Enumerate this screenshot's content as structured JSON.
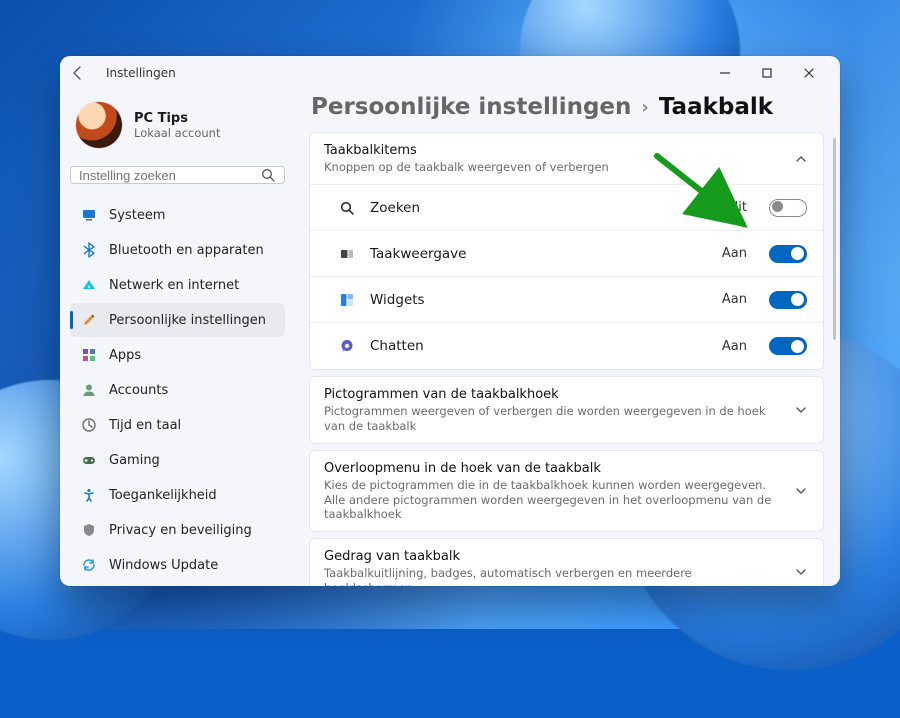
{
  "window": {
    "title": "Instellingen"
  },
  "profile": {
    "name": "PC Tips",
    "sub": "Lokaal account"
  },
  "search": {
    "placeholder": "Instelling zoeken"
  },
  "nav": [
    {
      "label": "Systeem",
      "icon": "display-icon",
      "selected": false,
      "color": "#1976d2"
    },
    {
      "label": "Bluetooth en apparaten",
      "icon": "bluetooth-icon",
      "selected": false,
      "color": "#1976d2"
    },
    {
      "label": "Netwerk en internet",
      "icon": "wifi-icon",
      "selected": false,
      "color": "#17a2d8"
    },
    {
      "label": "Persoonlijke instellingen",
      "icon": "paintbrush-icon",
      "selected": true,
      "color": "#e08a2c"
    },
    {
      "label": "Apps",
      "icon": "apps-icon",
      "selected": false,
      "color": "#7a52c7"
    },
    {
      "label": "Accounts",
      "icon": "person-icon",
      "selected": false,
      "color": "#5a8d6a"
    },
    {
      "label": "Tijd en taal",
      "icon": "clock-icon",
      "selected": false,
      "color": "#6a6a6a"
    },
    {
      "label": "Gaming",
      "icon": "gamepad-icon",
      "selected": false,
      "color": "#4a6a4a"
    },
    {
      "label": "Toegankelijkheid",
      "icon": "accessibility-icon",
      "selected": false,
      "color": "#1f7bd6"
    },
    {
      "label": "Privacy en beveiliging",
      "icon": "shield-icon",
      "selected": false,
      "color": "#6a6a6a"
    },
    {
      "label": "Windows Update",
      "icon": "update-icon",
      "selected": false,
      "color": "#1f9ed8"
    }
  ],
  "breadcrumb": {
    "parent": "Persoonlijke instellingen",
    "sep": "›",
    "current": "Taakbalk"
  },
  "sections": {
    "taskbar_items": {
      "title": "Taakbalkitems",
      "subtitle": "Knoppen op de taakbalk weergeven of verbergen",
      "expanded": true,
      "items": [
        {
          "label": "Zoeken",
          "state_label": "Uit",
          "on": false,
          "icon": "search-icon"
        },
        {
          "label": "Taakweergave",
          "state_label": "Aan",
          "on": true,
          "icon": "taskview-icon"
        },
        {
          "label": "Widgets",
          "state_label": "Aan",
          "on": true,
          "icon": "widgets-icon"
        },
        {
          "label": "Chatten",
          "state_label": "Aan",
          "on": true,
          "icon": "chat-icon"
        }
      ]
    },
    "corner_icons": {
      "title": "Pictogrammen van de taakbalkhoek",
      "subtitle": "Pictogrammen weergeven of verbergen die worden weergegeven in de hoek van de taakbalk",
      "expanded": false
    },
    "overflow_menu": {
      "title": "Overloopmenu in de hoek van de taakbalk",
      "subtitle": "Kies de pictogrammen die in de taakbalkhoek kunnen worden weergegeven. Alle andere pictogrammen worden weergegeven in het overloopmenu van de taakbalkhoek",
      "expanded": false
    },
    "behavior": {
      "title": "Gedrag van taakbalk",
      "subtitle": "Taakbalkuitlijning, badges, automatisch verbergen en meerdere beeldschermen",
      "expanded": false
    }
  },
  "annotation": {
    "arrow_color": "#159b1c"
  }
}
